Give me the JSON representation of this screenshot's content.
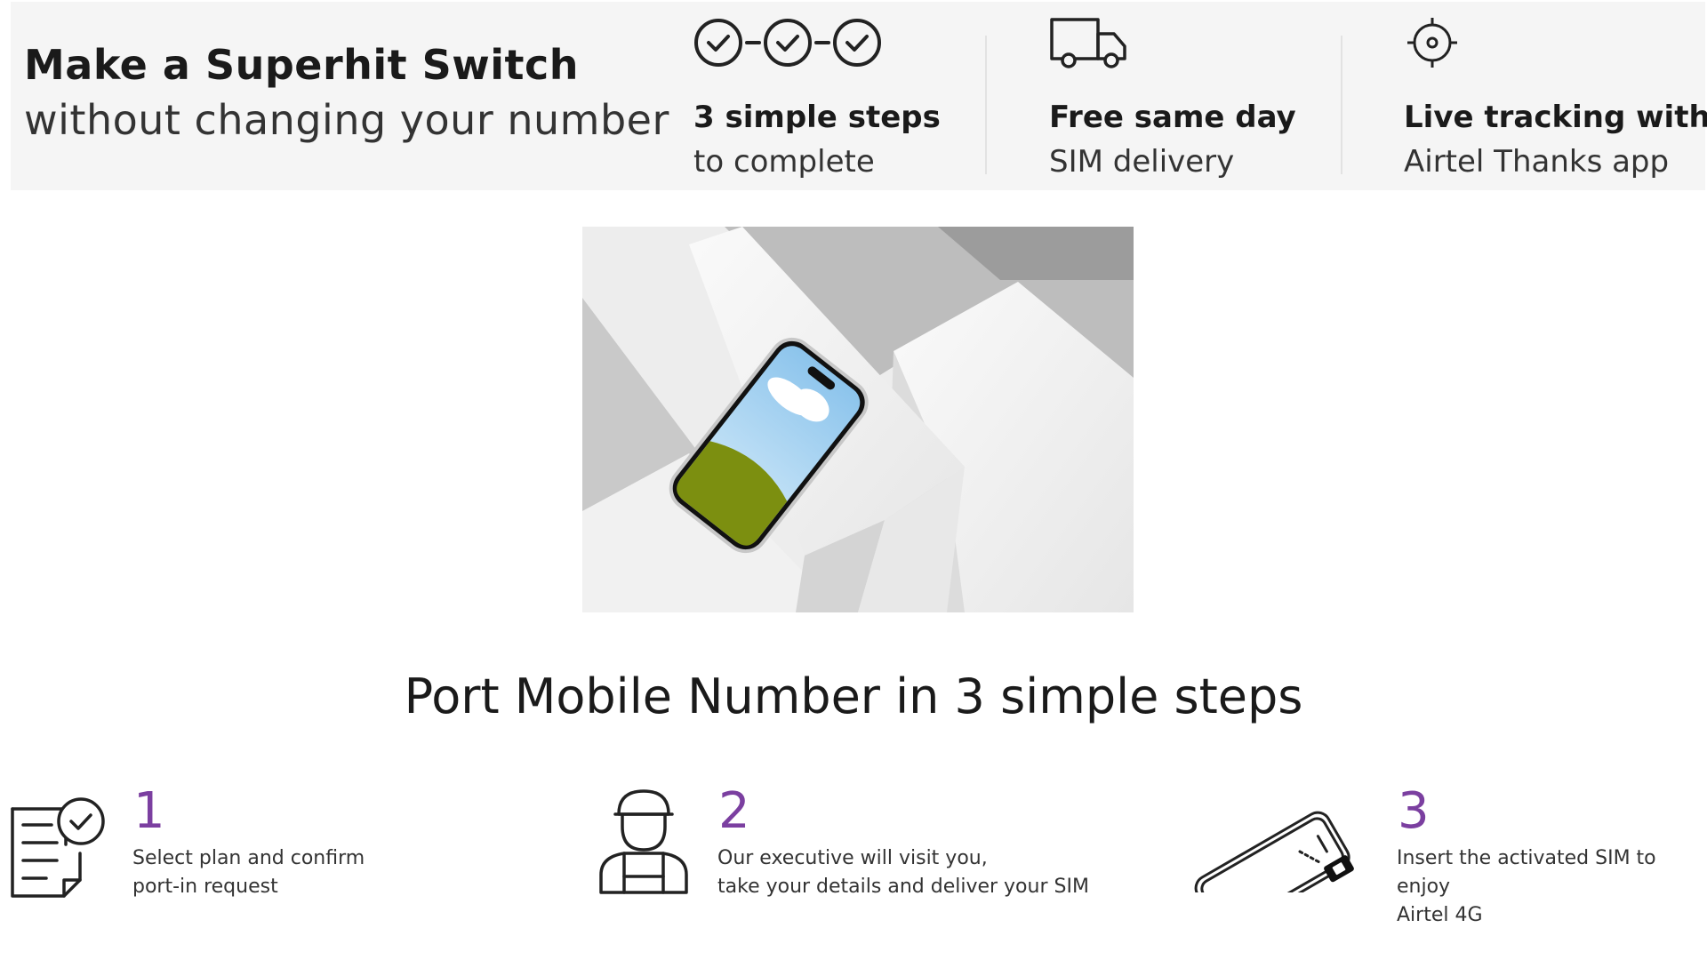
{
  "banner": {
    "title": "Make a Superhit Switch",
    "subtitle": "without changing your number",
    "features": [
      {
        "icon": "three-checkmarks-icon",
        "title": "3 simple steps",
        "text": "to complete"
      },
      {
        "icon": "delivery-truck-icon",
        "title": "Free same day",
        "text": "SIM delivery"
      },
      {
        "icon": "location-target-icon",
        "title": "Live tracking with",
        "text": "Airtel Thanks app"
      }
    ]
  },
  "hero": {
    "icon": "smartphone-on-blocks-image"
  },
  "section": {
    "title": "Port Mobile Number in 3 simple steps"
  },
  "steps": [
    {
      "number": "1",
      "icon": "document-check-icon",
      "text": "Select plan and confirm\nport-in request"
    },
    {
      "number": "2",
      "icon": "delivery-executive-icon",
      "text": "Our executive will visit you,\ntake your details and deliver your SIM"
    },
    {
      "number": "3",
      "icon": "phone-sim-card-icon",
      "text": "Insert the activated SIM to enjoy\n Airtel 4G"
    }
  ],
  "colors": {
    "accent": "#7b3fa0",
    "banner_bg": "#f5f5f5",
    "text": "#1a1a1a"
  }
}
